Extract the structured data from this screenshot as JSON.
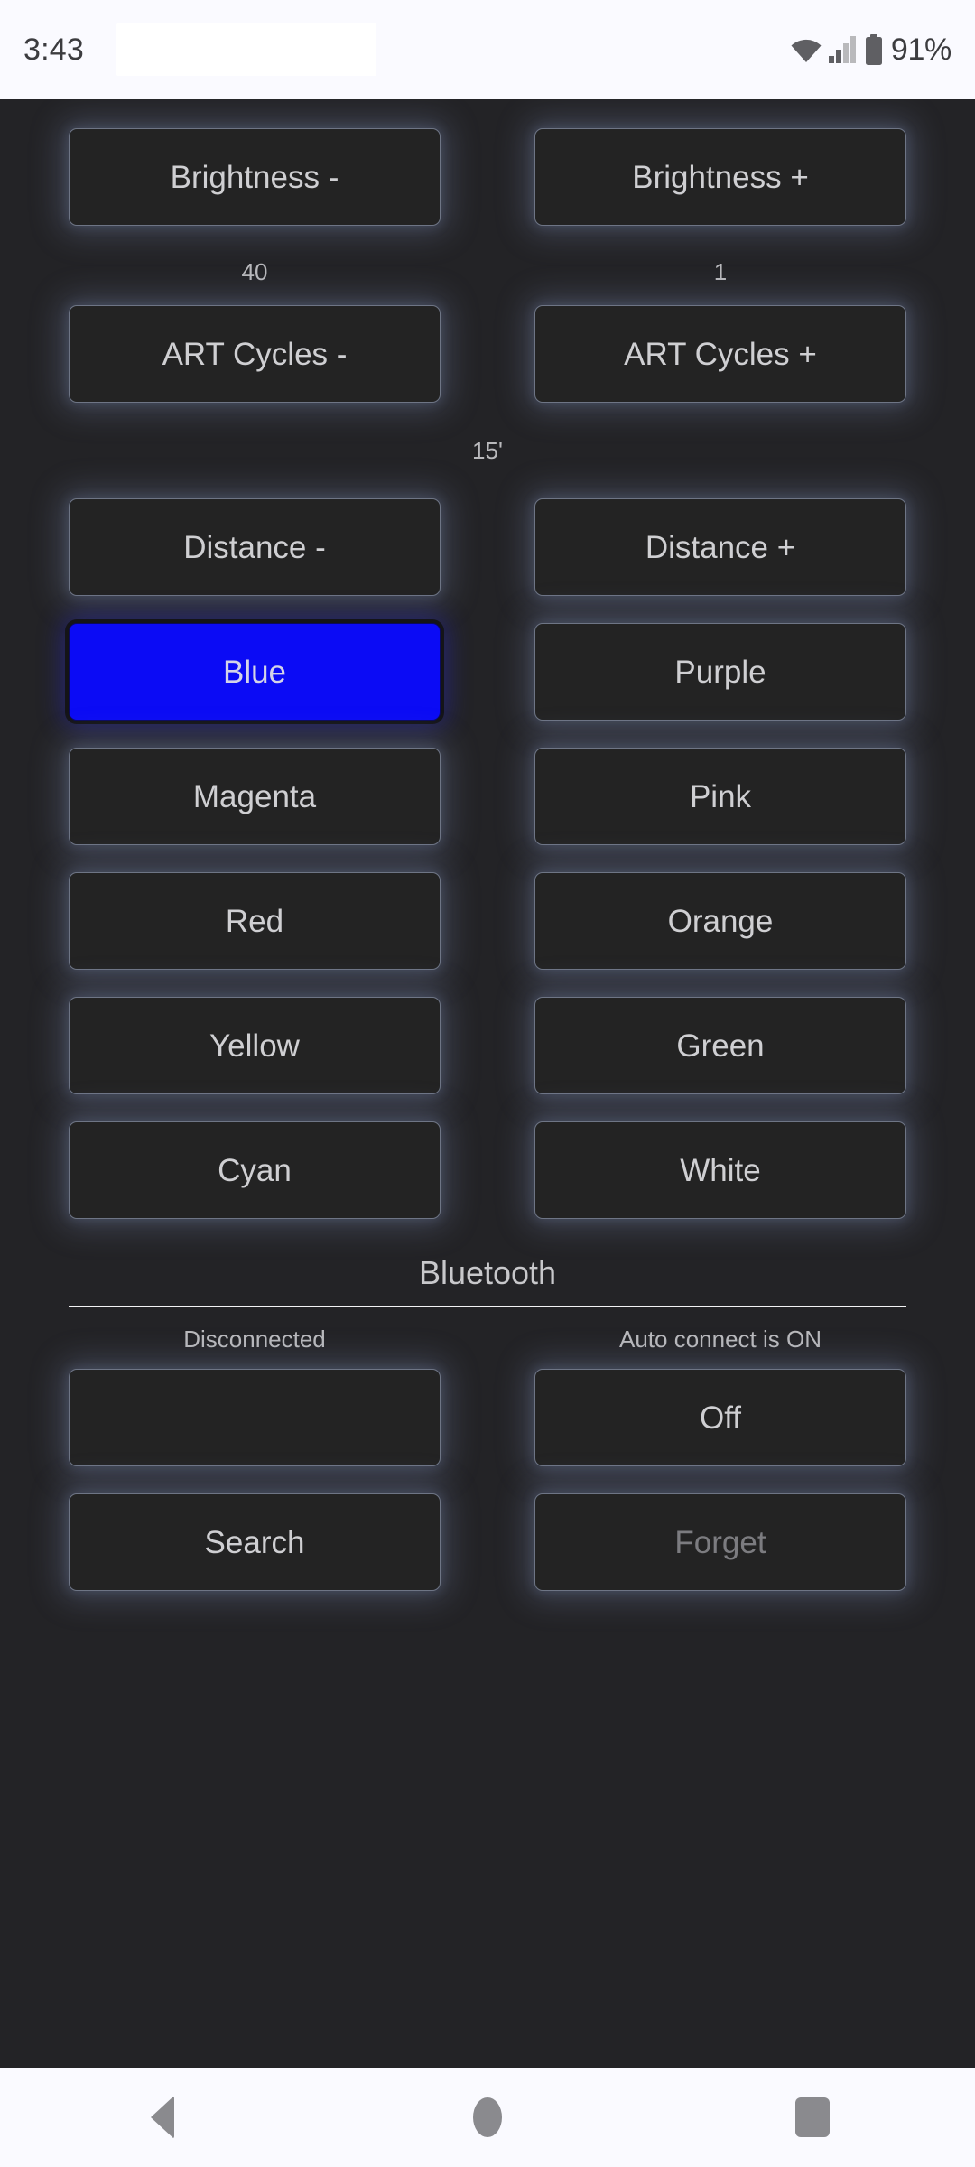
{
  "status_bar": {
    "clock": "3:43",
    "battery_percent": "91%",
    "icons": [
      "wifi-icon",
      "signal-icon",
      "battery-icon"
    ]
  },
  "controls": {
    "rows": [
      {
        "left": "Brightness -",
        "right": "Brightness +"
      },
      {
        "left": "ART Cycles -",
        "right": "ART Cycles +"
      },
      {
        "left": "Distance -",
        "right": "Distance +"
      },
      {
        "left": "Blue",
        "right": "Purple",
        "left_selected": true
      },
      {
        "left": "Magenta",
        "right": "Pink"
      },
      {
        "left": "Red",
        "right": "Orange"
      },
      {
        "left": "Yellow",
        "right": "Green"
      },
      {
        "left": "Cyan",
        "right": "White"
      }
    ],
    "brightness_value": "40",
    "art_cycles_value": "1",
    "distance_value": "15'"
  },
  "bluetooth": {
    "title": "Bluetooth",
    "connection_status": "Disconnected",
    "auto_connect_status": "Auto connect is ON",
    "device_button_label": "",
    "power_button_label": "Off",
    "search_button_label": "Search",
    "forget_button_label": "Forget"
  },
  "nav_bar": {
    "back": "back-icon",
    "home": "home-icon",
    "recents": "recents-icon"
  },
  "colors": {
    "page_background": "#232326",
    "button_fill": "#232323",
    "selected_blue": "#0b0bf5",
    "glow": "#7d8cb4",
    "text": "#cfcfd2"
  }
}
